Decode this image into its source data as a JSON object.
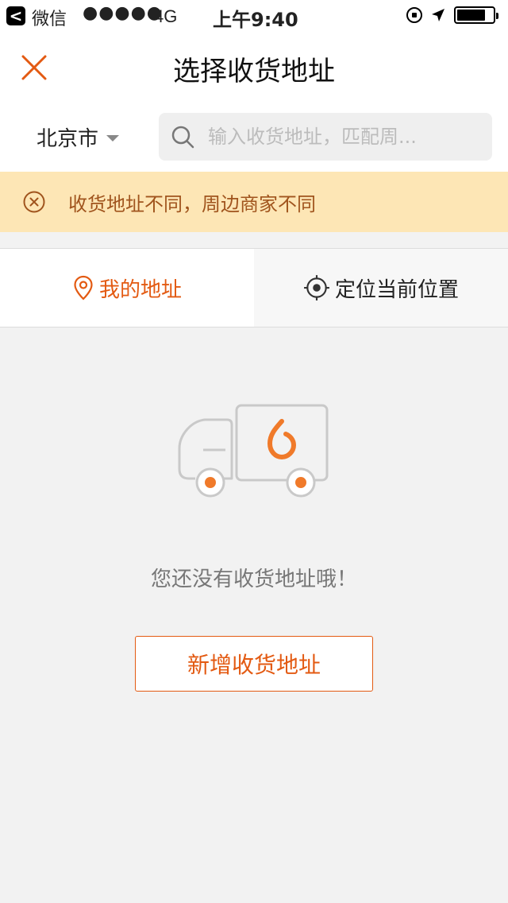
{
  "status_bar": {
    "back_glyph": "<",
    "app_name": "微信",
    "signal_dots": "●●●●●",
    "network": "4G",
    "time": "上午9:40",
    "battery_level": 0.8
  },
  "nav": {
    "title": "选择收货地址",
    "close_icon": "close-icon"
  },
  "city_selector": {
    "city": "北京市"
  },
  "search": {
    "placeholder": "输入收货地址，匹配周...",
    "value": ""
  },
  "notice": {
    "text": "收货地址不同，周边商家不同"
  },
  "tabs": [
    {
      "label": "我的地址",
      "icon": "location-pin-icon",
      "active": true
    },
    {
      "label": "定位当前位置",
      "icon": "crosshair-icon",
      "active": false
    }
  ],
  "empty_state": {
    "message": "您还没有收货地址哦！",
    "illustration": "delivery-truck-icon"
  },
  "actions": {
    "add_address_label": "新增收货地址"
  },
  "colors": {
    "accent": "#e35a12",
    "notice_bg": "#fde6b5",
    "notice_text": "#a0541d",
    "background": "#f2f2f2"
  }
}
